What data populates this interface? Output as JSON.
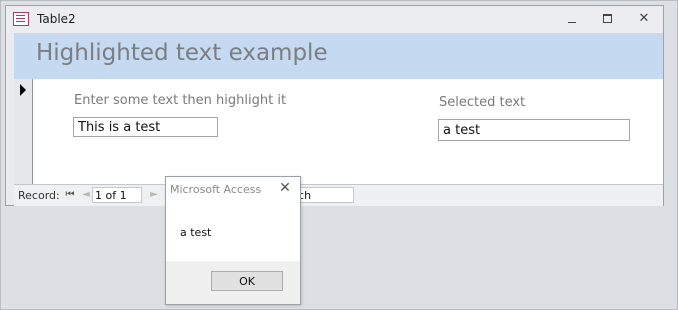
{
  "window": {
    "title": "Table2"
  },
  "form": {
    "header_title": "Highlighted text example",
    "left_label": "Enter some text then highlight it",
    "left_value": "This is a test",
    "right_label": "Selected text",
    "right_value": "a test"
  },
  "navigation": {
    "record_label": "Record:",
    "first_glyph": "⏮",
    "prev_glyph": "◄",
    "position": "1 of 1",
    "next_glyph": "►",
    "search_partial": "arch"
  },
  "dialog": {
    "title": "Microsoft Access",
    "close_glyph": "✕",
    "message": "a test",
    "ok_label": "OK"
  },
  "colors": {
    "header_band": "#c5d9f1",
    "icon_accent": "#b03a5b"
  },
  "icons": {
    "form_icon": "form-table-icon",
    "record_pointer": "record-selector-arrow-icon"
  }
}
